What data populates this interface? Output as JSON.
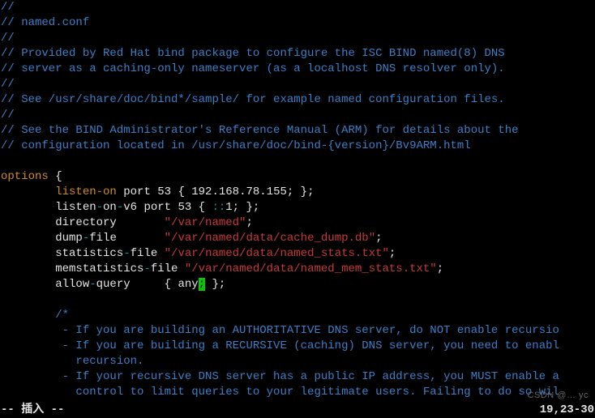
{
  "lines": [
    {
      "segments": [
        {
          "cls": "c-blue",
          "text": "//"
        }
      ]
    },
    {
      "segments": [
        {
          "cls": "c-blue",
          "text": "// named.conf"
        }
      ]
    },
    {
      "segments": [
        {
          "cls": "c-blue",
          "text": "//"
        }
      ]
    },
    {
      "segments": [
        {
          "cls": "c-blue",
          "text": "// Provided by Red Hat bind package to configure the ISC BIND named(8) DNS"
        }
      ]
    },
    {
      "segments": [
        {
          "cls": "c-blue",
          "text": "// server as a caching-only nameserver (as a localhost DNS resolver only)."
        }
      ]
    },
    {
      "segments": [
        {
          "cls": "c-blue",
          "text": "//"
        }
      ]
    },
    {
      "segments": [
        {
          "cls": "c-blue",
          "text": "// See /usr/share/doc/bind*/sample/ for example named configuration files."
        }
      ]
    },
    {
      "segments": [
        {
          "cls": "c-blue",
          "text": "//"
        }
      ]
    },
    {
      "segments": [
        {
          "cls": "c-blue",
          "text": "// See the BIND Administrator's Reference Manual (ARM) for details about the"
        }
      ]
    },
    {
      "segments": [
        {
          "cls": "c-blue",
          "text": "// configuration located in /usr/share/doc/bind-{version}/Bv9ARM.html"
        }
      ]
    },
    {
      "segments": [
        {
          "cls": "c-white",
          "text": ""
        }
      ]
    },
    {
      "segments": [
        {
          "cls": "c-yellow",
          "text": "options"
        },
        {
          "cls": "c-white",
          "text": " {"
        }
      ]
    },
    {
      "segments": [
        {
          "cls": "c-white",
          "text": "        "
        },
        {
          "cls": "c-yellow",
          "text": "listen-on"
        },
        {
          "cls": "c-white",
          "text": " port 53 { 192.168.78.155; };"
        }
      ]
    },
    {
      "segments": [
        {
          "cls": "c-white",
          "text": "        listen"
        },
        {
          "cls": "c-teal",
          "text": "-"
        },
        {
          "cls": "c-white",
          "text": "on"
        },
        {
          "cls": "c-teal",
          "text": "-"
        },
        {
          "cls": "c-white",
          "text": "v6 port 53 { "
        },
        {
          "cls": "c-teal",
          "text": "::"
        },
        {
          "cls": "c-white",
          "text": "1; };"
        }
      ]
    },
    {
      "segments": [
        {
          "cls": "c-white",
          "text": "        directory       "
        },
        {
          "cls": "c-red",
          "text": "\"/var/named\""
        },
        {
          "cls": "c-white",
          "text": ";"
        }
      ]
    },
    {
      "segments": [
        {
          "cls": "c-white",
          "text": "        dump"
        },
        {
          "cls": "c-teal",
          "text": "-"
        },
        {
          "cls": "c-white",
          "text": "file       "
        },
        {
          "cls": "c-red",
          "text": "\"/var/named/data/cache_dump.db\""
        },
        {
          "cls": "c-white",
          "text": ";"
        }
      ]
    },
    {
      "segments": [
        {
          "cls": "c-white",
          "text": "        statistics"
        },
        {
          "cls": "c-teal",
          "text": "-"
        },
        {
          "cls": "c-white",
          "text": "file "
        },
        {
          "cls": "c-red",
          "text": "\"/var/named/data/named_stats.txt\""
        },
        {
          "cls": "c-white",
          "text": ";"
        }
      ]
    },
    {
      "segments": [
        {
          "cls": "c-white",
          "text": "        memstatistics"
        },
        {
          "cls": "c-teal",
          "text": "-"
        },
        {
          "cls": "c-white",
          "text": "file "
        },
        {
          "cls": "c-red",
          "text": "\"/var/named/data/named_mem_stats.txt\""
        },
        {
          "cls": "c-white",
          "text": ";"
        }
      ]
    },
    {
      "segments": [
        {
          "cls": "c-white",
          "text": "        allow"
        },
        {
          "cls": "c-teal",
          "text": "-"
        },
        {
          "cls": "c-white",
          "text": "query     { any"
        },
        {
          "cls": "cursor",
          "text": ";"
        },
        {
          "cls": "c-white",
          "text": " };"
        }
      ]
    },
    {
      "segments": [
        {
          "cls": "c-white",
          "text": ""
        }
      ]
    },
    {
      "segments": [
        {
          "cls": "c-blue",
          "text": "        /*"
        }
      ]
    },
    {
      "segments": [
        {
          "cls": "c-blue",
          "text": "         - If you are building an AUTHORITATIVE DNS server, do NOT enable recursio"
        }
      ]
    },
    {
      "segments": [
        {
          "cls": "c-blue",
          "text": "         - If you are building a RECURSIVE (caching) DNS server, you need to enabl"
        }
      ]
    },
    {
      "segments": [
        {
          "cls": "c-blue",
          "text": "           recursion."
        }
      ]
    },
    {
      "segments": [
        {
          "cls": "c-blue",
          "text": "         - If your recursive DNS server has a public IP address, you MUST enable a"
        }
      ]
    },
    {
      "segments": [
        {
          "cls": "c-blue",
          "text": "           control to limit queries to your legitimate users. Failing to do so wil"
        }
      ]
    }
  ],
  "status": {
    "mode": "-- 插入 --",
    "position": "19,23-30"
  },
  "watermark": "CSDN @… yc"
}
